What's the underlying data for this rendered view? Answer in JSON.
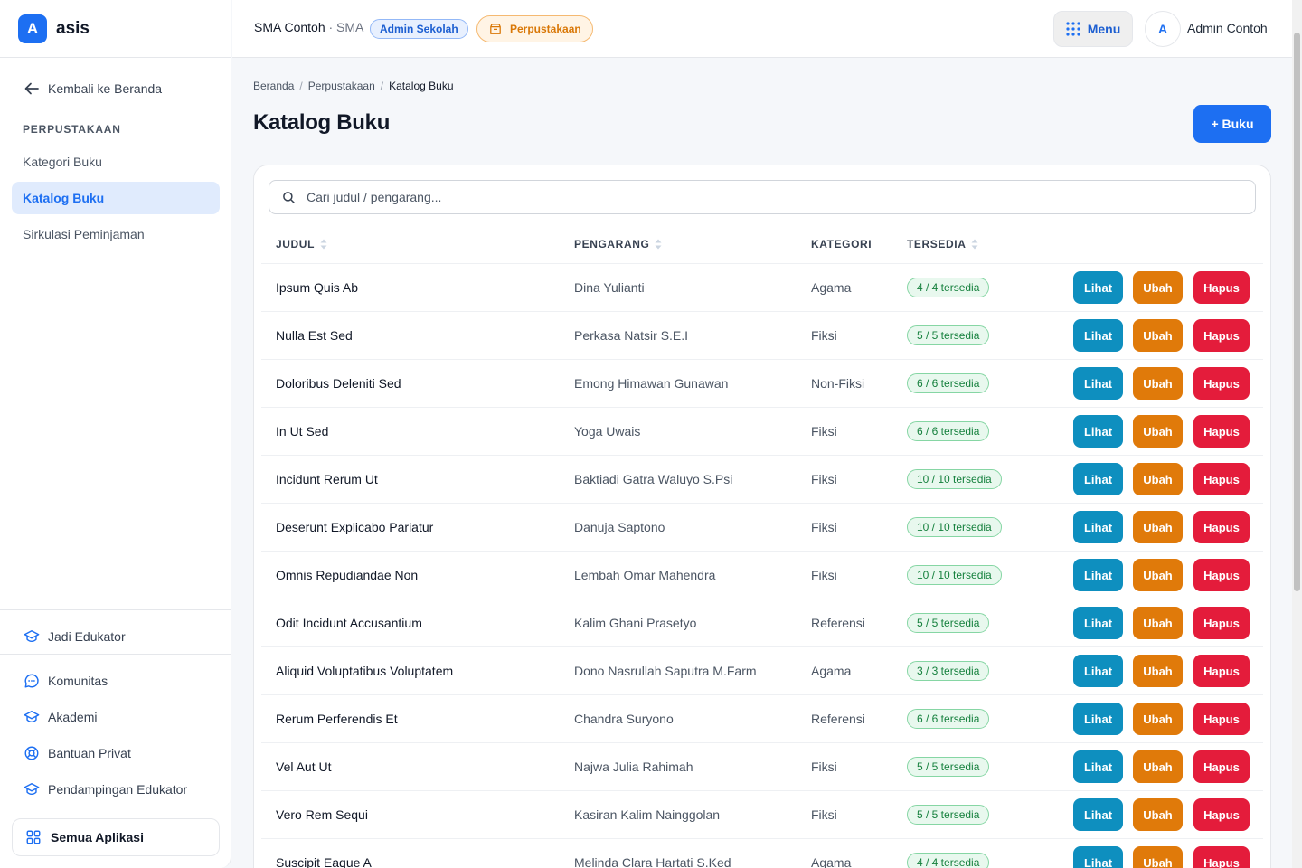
{
  "brand": {
    "logo_letter": "A",
    "name": "asis"
  },
  "sidebar": {
    "back_label": "Kembali ke Beranda",
    "section_title": "PERPUSTAKAAN",
    "items": [
      {
        "label": "Kategori Buku"
      },
      {
        "label": "Katalog Buku"
      },
      {
        "label": "Sirkulasi Peminjaman"
      }
    ],
    "bottom_links": [
      {
        "label": "Jadi Edukator",
        "icon": "graduation-cap-icon"
      },
      {
        "label": "Komunitas",
        "icon": "chat-bubble-icon"
      },
      {
        "label": "Akademi",
        "icon": "graduation-cap-icon"
      },
      {
        "label": "Bantuan Privat",
        "icon": "lifebuoy-icon"
      },
      {
        "label": "Pendampingan Edukator",
        "icon": "graduation-cap-icon"
      }
    ],
    "all_apps_label": "Semua Aplikasi"
  },
  "topbar": {
    "school_name": "SMA Contoh",
    "school_level": "· SMA",
    "role_badge": "Admin Sekolah",
    "module_badge": "Perpustakaan",
    "menu_label": "Menu",
    "avatar_letter": "A",
    "user_name": "Admin Contoh"
  },
  "breadcrumb": [
    "Beranda",
    "Perpustakaan",
    "Katalog Buku"
  ],
  "page": {
    "title": "Katalog Buku",
    "add_button": "+ Buku"
  },
  "search": {
    "placeholder": "Cari judul / pengarang..."
  },
  "table": {
    "headers": [
      "JUDUL",
      "PENGARANG",
      "KATEGORI",
      "TERSEDIA"
    ],
    "actions": {
      "view": "Lihat",
      "edit": "Ubah",
      "delete": "Hapus"
    },
    "rows": [
      {
        "title": "Ipsum Quis Ab",
        "author": "Dina Yulianti",
        "category": "Agama",
        "available": "4 / 4 tersedia"
      },
      {
        "title": "Nulla Est Sed",
        "author": "Perkasa Natsir S.E.I",
        "category": "Fiksi",
        "available": "5 / 5 tersedia"
      },
      {
        "title": "Doloribus Deleniti Sed",
        "author": "Emong Himawan Gunawan",
        "category": "Non-Fiksi",
        "available": "6 / 6 tersedia"
      },
      {
        "title": "In Ut Sed",
        "author": "Yoga Uwais",
        "category": "Fiksi",
        "available": "6 / 6 tersedia"
      },
      {
        "title": "Incidunt Rerum Ut",
        "author": "Baktiadi Gatra Waluyo S.Psi",
        "category": "Fiksi",
        "available": "10 / 10 tersedia"
      },
      {
        "title": "Deserunt Explicabo Pariatur",
        "author": "Danuja Saptono",
        "category": "Fiksi",
        "available": "10 / 10 tersedia"
      },
      {
        "title": "Omnis Repudiandae Non",
        "author": "Lembah Omar Mahendra",
        "category": "Fiksi",
        "available": "10 / 10 tersedia"
      },
      {
        "title": "Odit Incidunt Accusantium",
        "author": "Kalim Ghani Prasetyo",
        "category": "Referensi",
        "available": "5 / 5 tersedia"
      },
      {
        "title": "Aliquid Voluptatibus Voluptatem",
        "author": "Dono Nasrullah Saputra M.Farm",
        "category": "Agama",
        "available": "3 / 3 tersedia"
      },
      {
        "title": "Rerum Perferendis Et",
        "author": "Chandra Suryono",
        "category": "Referensi",
        "available": "6 / 6 tersedia"
      },
      {
        "title": "Vel Aut Ut",
        "author": "Najwa Julia Rahimah",
        "category": "Fiksi",
        "available": "5 / 5 tersedia"
      },
      {
        "title": "Vero Rem Sequi",
        "author": "Kasiran Kalim Nainggolan",
        "category": "Fiksi",
        "available": "5 / 5 tersedia"
      },
      {
        "title": "Suscipit Eaque A",
        "author": "Melinda Clara Hartati S.Ked",
        "category": "Agama",
        "available": "4 / 4 tersedia"
      }
    ]
  },
  "colors": {
    "primary": "#1d6ff2",
    "view_button": "#0e8fbf",
    "edit_button": "#e07a0a",
    "delete_button": "#e41c3b",
    "available_badge": "#15803d"
  }
}
